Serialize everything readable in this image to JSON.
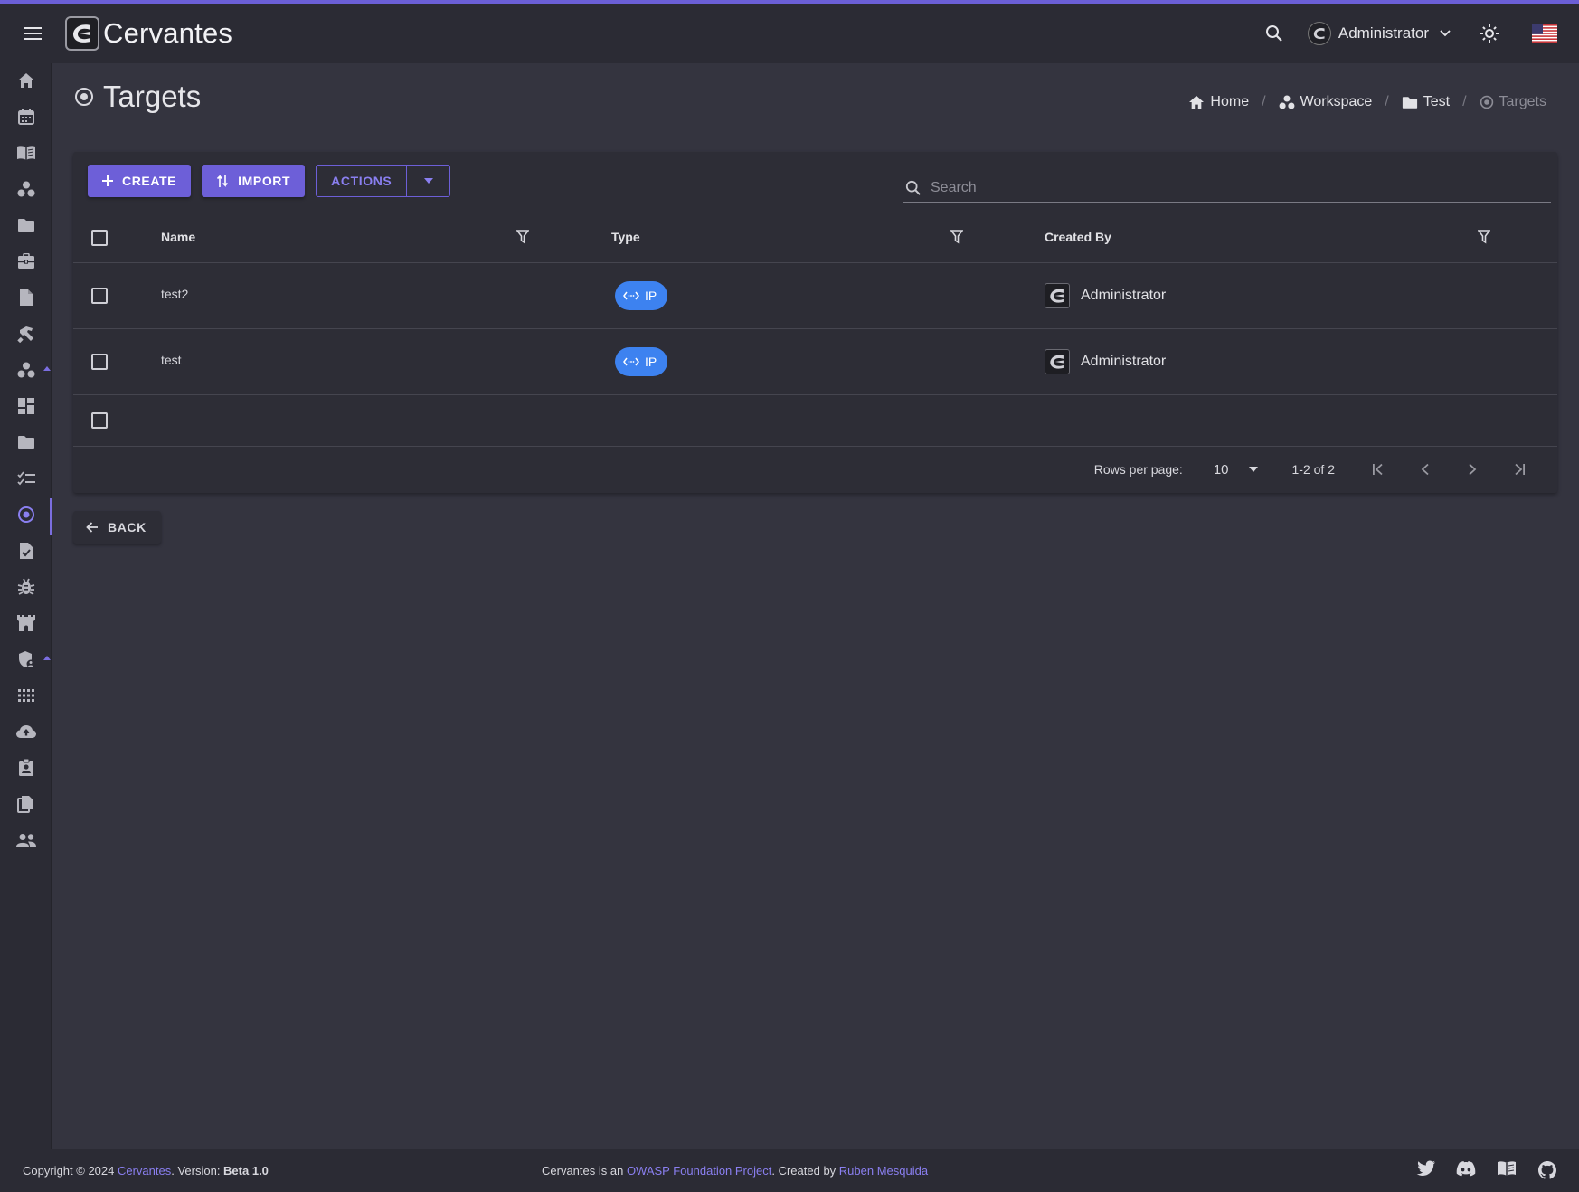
{
  "app": {
    "name": "Cervantes"
  },
  "header": {
    "user_name": "Administrator",
    "language": "en-US"
  },
  "page": {
    "title": "Targets"
  },
  "breadcrumb": [
    {
      "label": "Home",
      "icon": "home-icon"
    },
    {
      "label": "Workspace",
      "icon": "workspace-icon"
    },
    {
      "label": "Test",
      "icon": "folder-icon"
    },
    {
      "label": "Targets",
      "icon": "target-icon"
    }
  ],
  "sidebar": {
    "items": [
      "home",
      "calendar",
      "vault",
      "workspaces",
      "projects",
      "clients",
      "documents",
      "tasks",
      "workspace",
      "dashboard",
      "folder",
      "checklists",
      "targets",
      "reports",
      "vulnerabilities",
      "knowledge-base",
      "security",
      "apps",
      "upload",
      "user-profile",
      "templates",
      "users"
    ],
    "active": "targets"
  },
  "toolbar": {
    "create_label": "CREATE",
    "import_label": "IMPORT",
    "actions_label": "ACTIONS",
    "search_placeholder": "Search"
  },
  "table": {
    "columns": [
      "Name",
      "Type",
      "Created By"
    ],
    "rows": [
      {
        "name": "test2",
        "type": "IP",
        "created_by": "Administrator"
      },
      {
        "name": "test",
        "type": "IP",
        "created_by": "Administrator"
      }
    ]
  },
  "pagination": {
    "rows_per_page_label": "Rows per page:",
    "rows_per_page_value": "10",
    "range": "1-2 of 2"
  },
  "back_label": "BACK",
  "footer": {
    "copyright_prefix": "Copyright © 2024 ",
    "copyright_link": "Cervantes",
    "version_prefix": ". Version: ",
    "version": "Beta 1.0",
    "mid_prefix": "Cervantes is an ",
    "owasp_link": "OWASP Foundation Project",
    "created_by": ". Created by ",
    "author_link": "Ruben Mesquida"
  },
  "colors": {
    "accent": "#6d5fd8",
    "chip": "#3d82f0",
    "background": "#34343f",
    "surface": "#2b2b34"
  }
}
